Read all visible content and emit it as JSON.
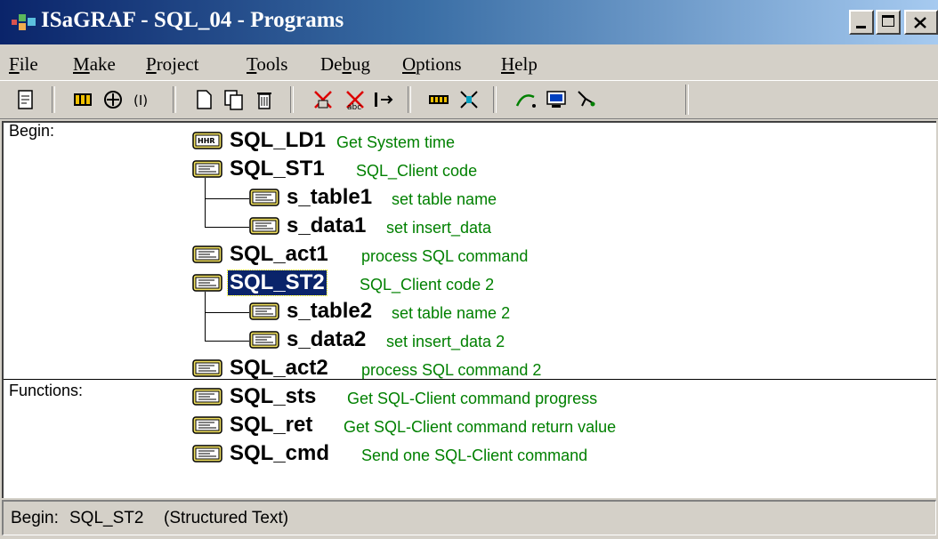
{
  "window": {
    "title": "ISaGRAF - SQL_04 - Programs"
  },
  "menu": [
    {
      "u": "F",
      "rest": "ile"
    },
    {
      "u": "M",
      "rest": "ake"
    },
    {
      "u": "P",
      "rest": "roject"
    },
    {
      "u": "T",
      "rest": "ools"
    },
    {
      "u": "",
      "pre": "De",
      "mid": "b",
      "rest": "ug"
    },
    {
      "u": "O",
      "rest": "ptions"
    },
    {
      "u": "H",
      "rest": "elp"
    }
  ],
  "sections": {
    "begin": "Begin:",
    "functions": "Functions:"
  },
  "programs": [
    {
      "name": "SQL_LD1",
      "desc": "Get System time",
      "icon": "ladder-icon"
    },
    {
      "name": "SQL_ST1",
      "desc": "SQL_Client code",
      "icon": "st-program-icon"
    },
    {
      "name": "s_table1",
      "desc": "set table name",
      "icon": "st-program-icon"
    },
    {
      "name": "s_data1",
      "desc": "set insert_data",
      "icon": "st-program-icon"
    },
    {
      "name": "SQL_act1",
      "desc": "process SQL command",
      "icon": "st-program-icon"
    },
    {
      "name": "SQL_ST2",
      "desc": "SQL_Client code 2",
      "icon": "st-program-icon"
    },
    {
      "name": "s_table2",
      "desc": "set table name 2",
      "icon": "st-program-icon"
    },
    {
      "name": "s_data2",
      "desc": "set insert_data 2",
      "icon": "st-program-icon"
    },
    {
      "name": "SQL_act2",
      "desc": "process SQL command 2",
      "icon": "st-program-icon"
    }
  ],
  "functions": [
    {
      "name": "SQL_sts",
      "desc": "Get SQL-Client command progress",
      "icon": "st-program-icon"
    },
    {
      "name": "SQL_ret",
      "desc": "Get SQL-Client command return value",
      "icon": "st-program-icon"
    },
    {
      "name": "SQL_cmd",
      "desc": "Send one SQL-Client command",
      "icon": "st-program-icon"
    }
  ],
  "status": {
    "section": "Begin:",
    "program": "SQL_ST2",
    "language": "(Structured Text)"
  },
  "colors": {
    "titlebar": "#0a246a",
    "selection": "#0a246a",
    "description": "#008000"
  }
}
